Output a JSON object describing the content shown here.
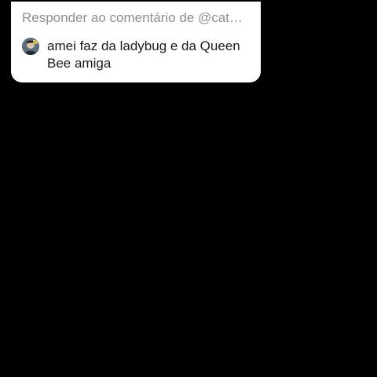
{
  "reply_card": {
    "header": "Responder ao comentário de @cat…",
    "avatar_icon": "user-avatar-icon",
    "comment": "amei faz da ladybug e da Queen Bee amiga"
  },
  "colors": {
    "background": "#000000",
    "card": "#ffffff",
    "header_text": "#8f8f8f",
    "comment_text": "#1b1b1b"
  }
}
